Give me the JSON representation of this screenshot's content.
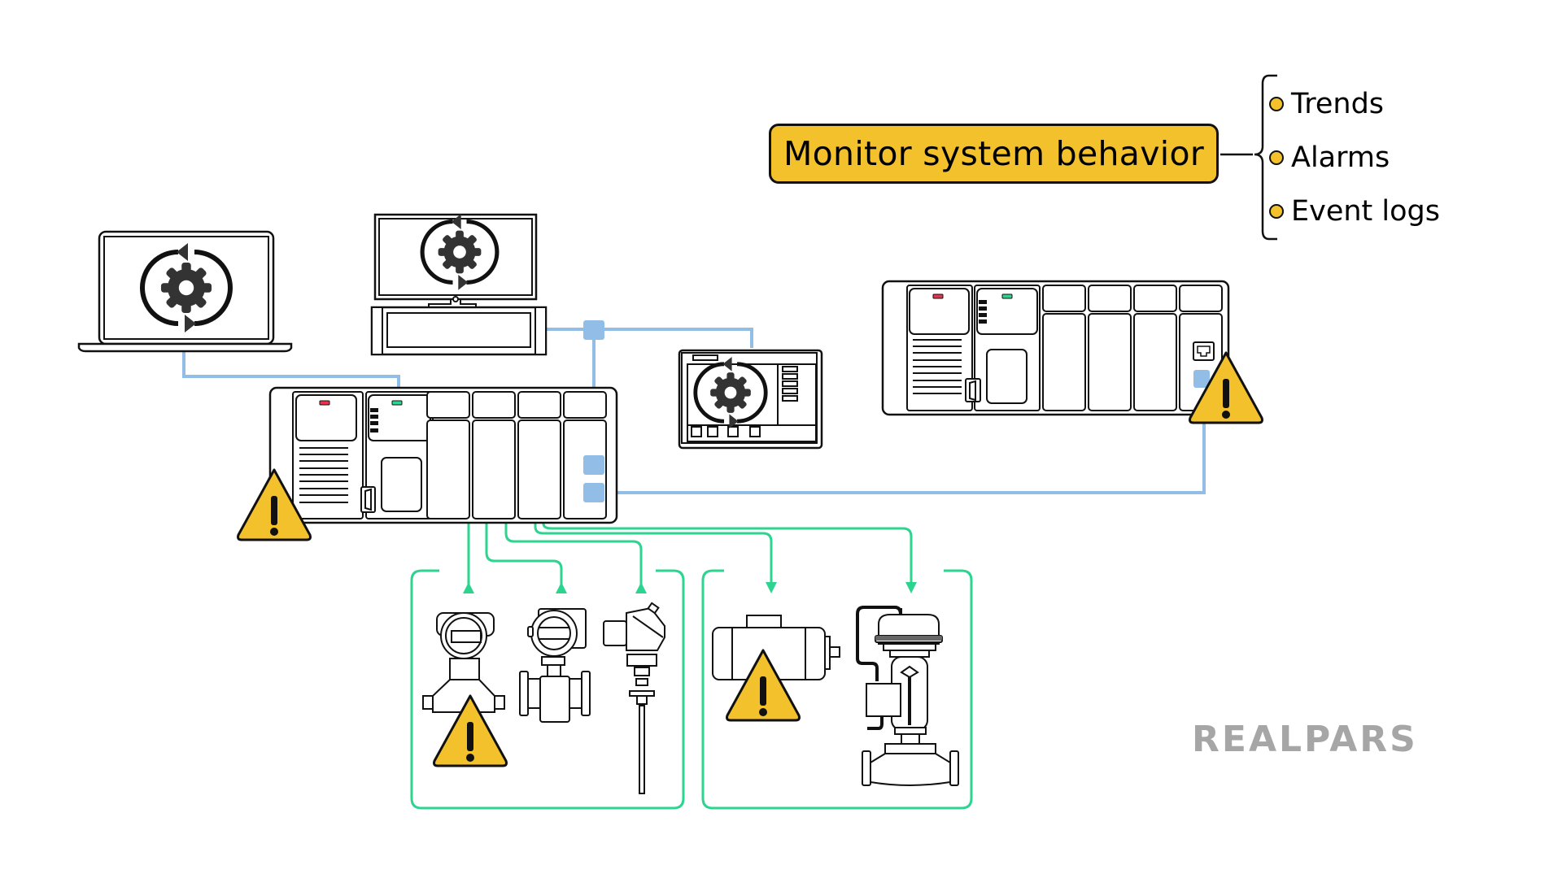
{
  "header": {
    "title": "Monitor system behavior",
    "items": [
      {
        "label": "Trends"
      },
      {
        "label": "Alarms"
      },
      {
        "label": "Event logs"
      }
    ]
  },
  "devices": {
    "laptop": {
      "icon": "gear-refresh-icon"
    },
    "workstation": {
      "icon": "gear-refresh-icon"
    },
    "hmi_panel": {
      "icon": "gear-refresh-icon"
    },
    "plc_main": {
      "alarm": true
    },
    "plc_remote": {
      "alarm": true
    },
    "field_inputs": [
      "pressure-transmitter",
      "flow-meter",
      "temperature-sensor"
    ],
    "field_outputs": [
      "motor",
      "control-valve"
    ],
    "alarms_on": [
      "plc_main",
      "plc_remote",
      "pressure-transmitter",
      "motor"
    ]
  },
  "colors": {
    "accent": "#f3c12c",
    "network": "#92bde6",
    "io_signal": "#2dd48f",
    "led_red": "#e8334a",
    "led_green": "#2dd48f",
    "logo": "#a6a6a6"
  },
  "logo": {
    "text": "REALPARS"
  }
}
